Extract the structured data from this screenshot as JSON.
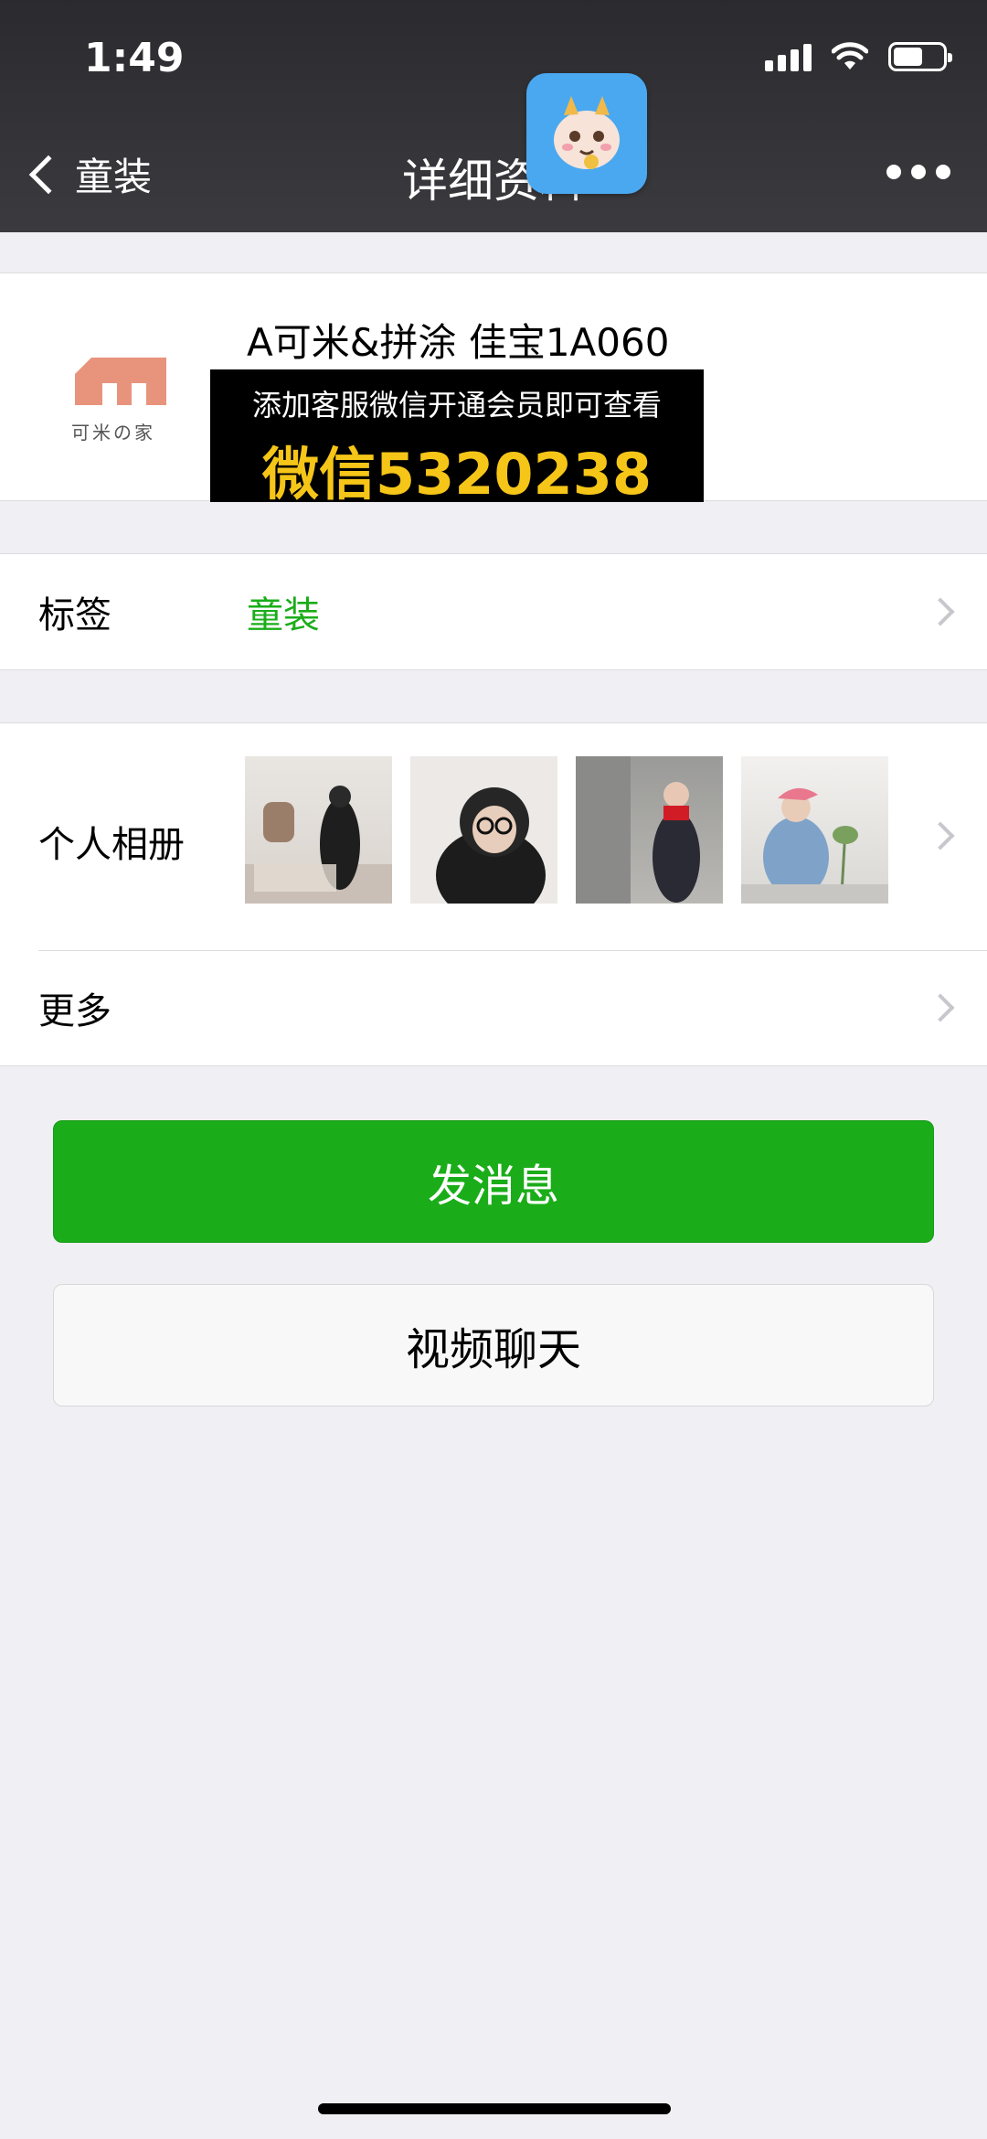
{
  "status_bar": {
    "time": "1:49"
  },
  "nav": {
    "back_label": "童装",
    "title": "详细资料"
  },
  "profile": {
    "name": "A可米&拼涂 佳宝1A060",
    "logo_text": "可米の家",
    "promo_line1": "添加客服微信开通会员即可查看",
    "promo_line2": "微信5320238"
  },
  "tag_row": {
    "label": "标签",
    "value": "童装"
  },
  "album_row": {
    "label": "个人相册"
  },
  "more_row": {
    "label": "更多"
  },
  "buttons": {
    "message": "发消息",
    "video_call": "视频聊天"
  },
  "colors": {
    "accent": "#1aad19",
    "topbar": "#333336",
    "promo_yellow": "#f5c518",
    "logo": "#e8947c"
  }
}
